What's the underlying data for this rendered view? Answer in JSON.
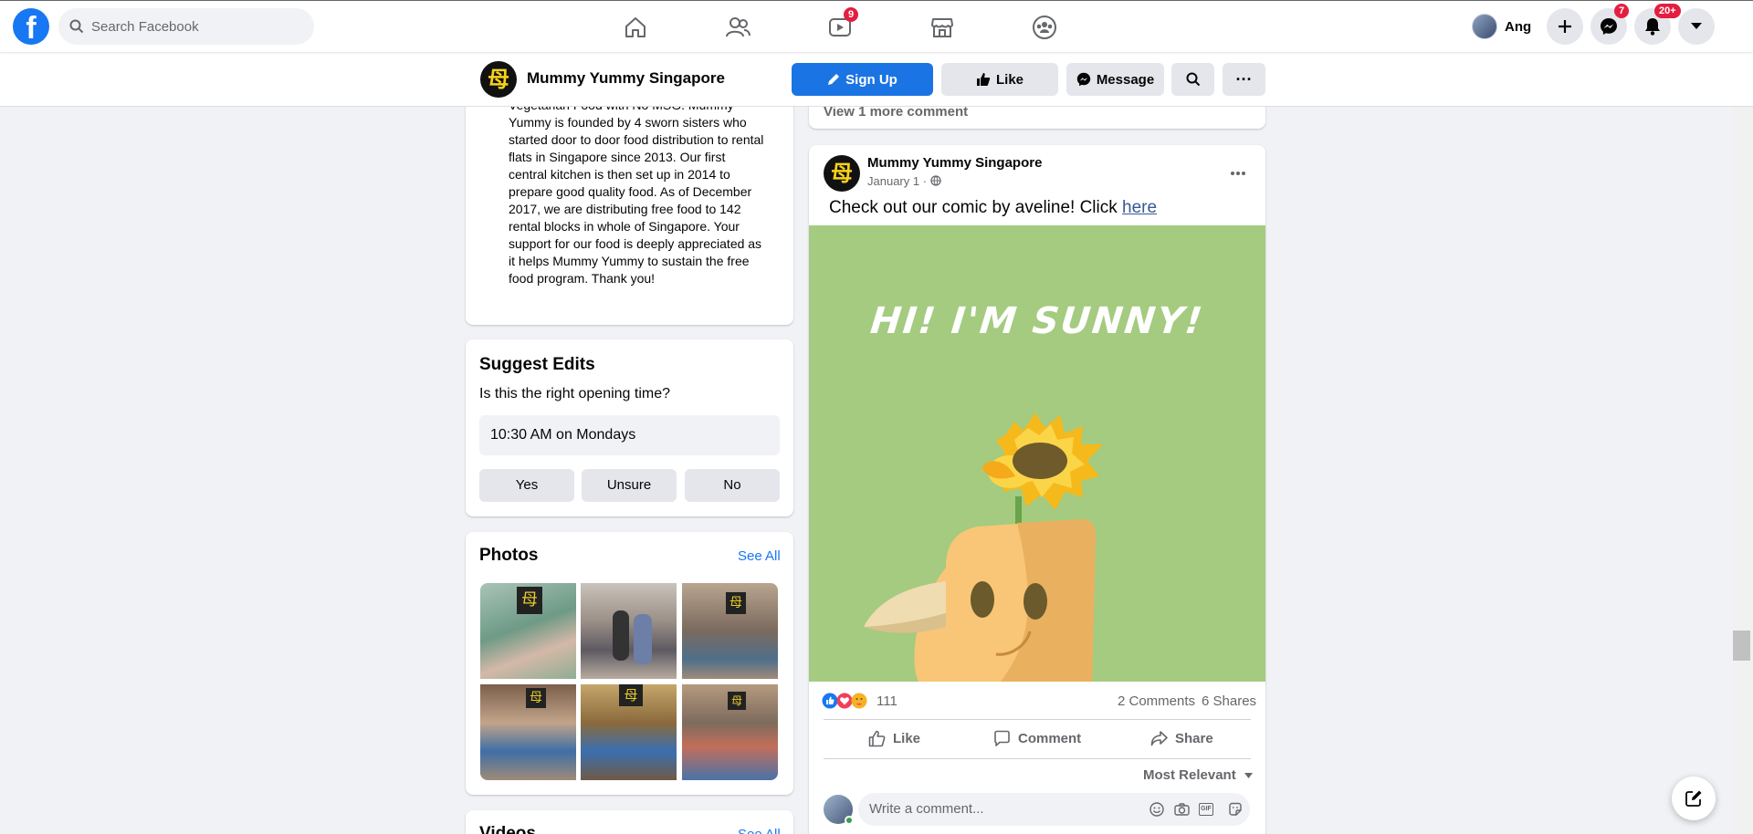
{
  "topbar": {
    "logo_letter": "f",
    "search_placeholder": "Search Facebook",
    "watch_badge": "9",
    "profile_name": "Ang",
    "messenger_badge": "7",
    "notif_badge": "20+",
    "icons": [
      "home-icon",
      "friends-icon",
      "watch-icon",
      "marketplace-icon",
      "groups-icon"
    ]
  },
  "pagebar": {
    "logo_char": "母",
    "page_name": "Mummy Yummy Singapore",
    "signup": "Sign Up",
    "like": "Like",
    "message": "Message",
    "more": "···"
  },
  "about": {
    "text": "Vegetarian Food with No MSG. Mummy Yummy is founded by 4 sworn sisters who started door to door food distribution to rental flats in Singapore since 2013. Our first central kitchen is then set up in 2014 to prepare good quality food. As of December 2017, we are distributing free food to 142 rental blocks in whole of Singapore. Your support for our food is deeply appreciated as it helps Mummy Yummy to sustain the free food program. Thank you!"
  },
  "suggest_edits": {
    "title": "Suggest Edits",
    "question": "Is this the right opening time?",
    "value": "10:30 AM on Mondays",
    "yes": "Yes",
    "unsure": "Unsure",
    "no": "No"
  },
  "photos": {
    "title": "Photos",
    "see_all": "See All"
  },
  "videos": {
    "title": "Videos",
    "see_all": "See All"
  },
  "prev_post": {
    "view_more": "View 1 more comment"
  },
  "post": {
    "author": "Mummy Yummy Singapore",
    "date": "January 1 ·",
    "text": "Check out our comic by aveline! Click ",
    "link": "here",
    "image_caption": "HI! I'M SUNNY!",
    "reaction_count": "111",
    "comments": "2 Comments",
    "shares": "6 Shares",
    "like": "Like",
    "comment": "Comment",
    "share": "Share",
    "most_relevant": "Most Relevant",
    "comment_placeholder": "Write a comment...",
    "gif_label": "GIF"
  },
  "colors": {
    "brand": "#1877f2",
    "badge": "#e41e3f",
    "image_bg": "#a4cb7f"
  }
}
